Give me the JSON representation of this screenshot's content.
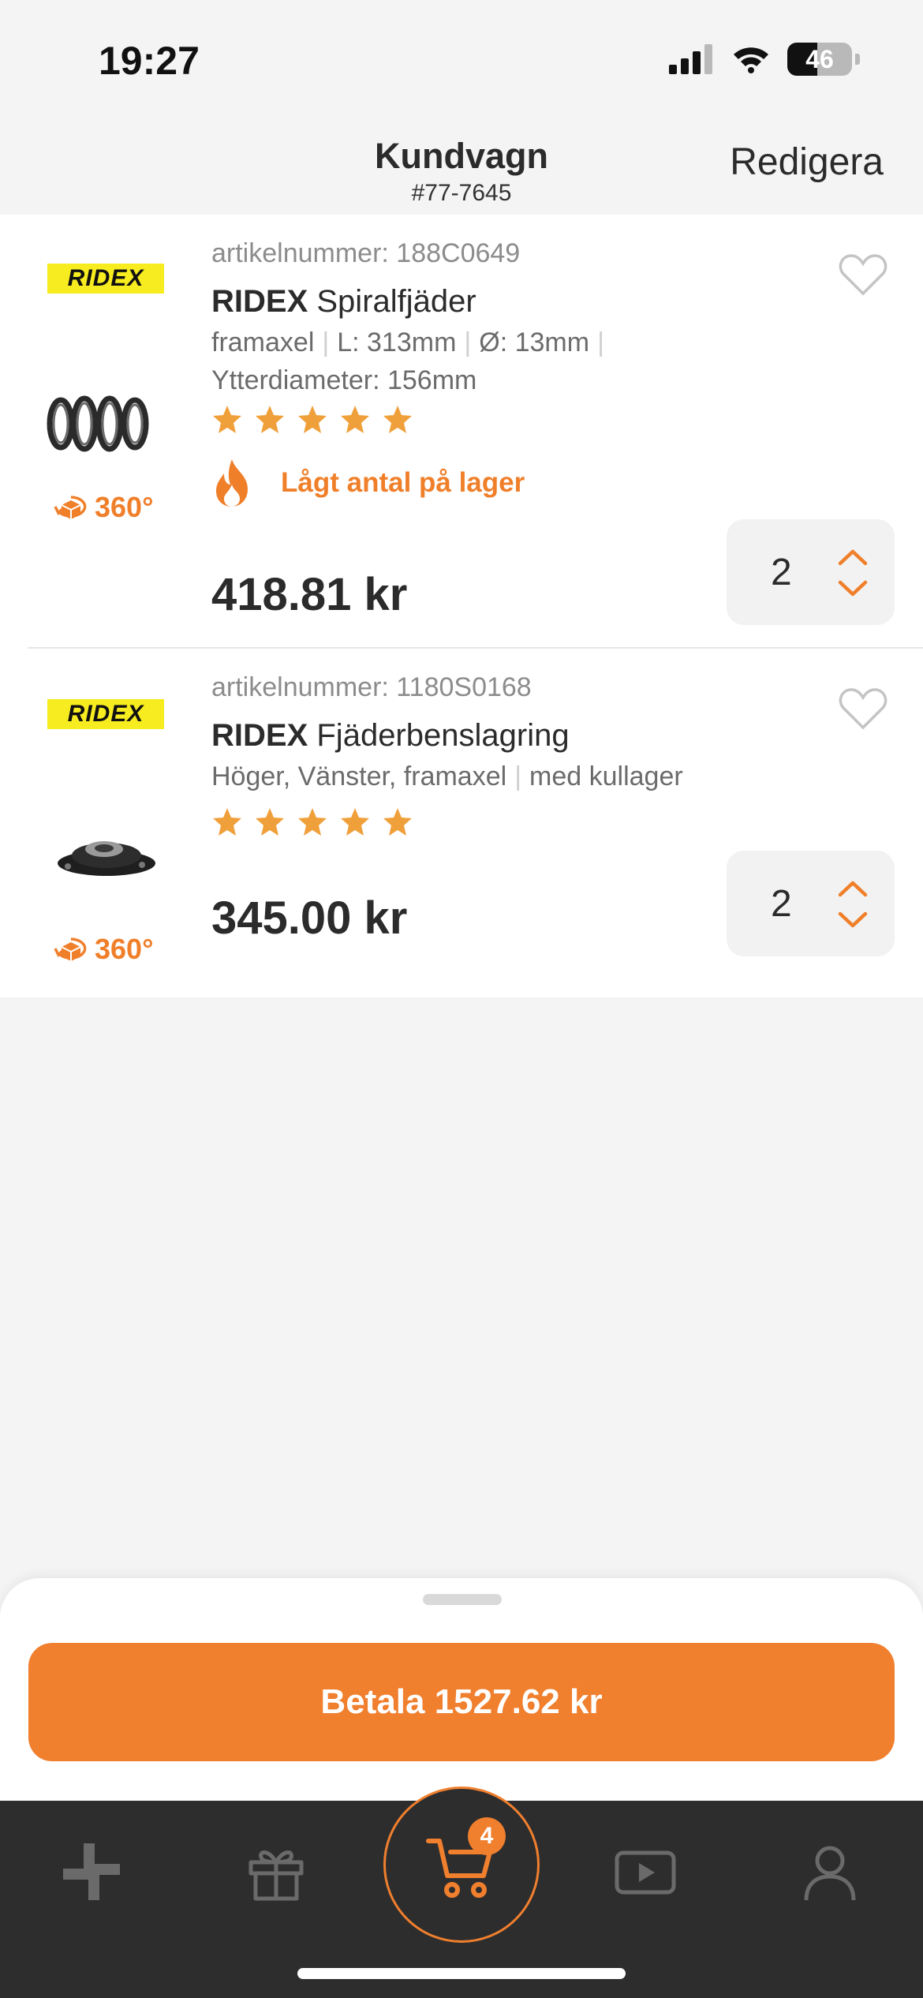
{
  "status_bar": {
    "time": "19:27",
    "battery_level": "46",
    "battery_fraction": 0.46
  },
  "header": {
    "title": "Kundvagn",
    "subtitle": "#77-7645",
    "edit_label": "Redigera"
  },
  "items": [
    {
      "brand_logo": "RIDEX",
      "article_label": "artikelnummer: 188C0649",
      "brand": "RIDEX",
      "name": "Spiralfjäder",
      "specs": [
        "framaxel",
        "L: 313mm",
        "Ø: 13mm",
        "Ytterdiameter: 156mm"
      ],
      "rating": 5,
      "stock_notice": "Lågt antal på lager",
      "price": "418.81 kr",
      "quantity": "2",
      "view360_label": "360°"
    },
    {
      "brand_logo": "RIDEX",
      "article_label": "artikelnummer: 1180S0168",
      "brand": "RIDEX",
      "name": "Fjäderbenslagring",
      "specs": [
        "Höger, Vänster, framaxel",
        "med kullager"
      ],
      "rating": 5,
      "price": "345.00 kr",
      "quantity": "2",
      "view360_label": "360°"
    }
  ],
  "checkout": {
    "pay_label": "Betala 1527.62 kr"
  },
  "tab_bar": {
    "tabs": [
      {
        "icon": "parts-icon"
      },
      {
        "icon": "gift-icon"
      },
      {
        "icon": "cart-icon",
        "active": true
      },
      {
        "icon": "video-icon"
      },
      {
        "icon": "profile-icon"
      }
    ],
    "cart_badge": "4"
  },
  "colors": {
    "accent": "#f07f2e",
    "star": "#f0a03a",
    "brand_yellow": "#f7ec1f",
    "tab_bar": "#2d2d2d"
  }
}
